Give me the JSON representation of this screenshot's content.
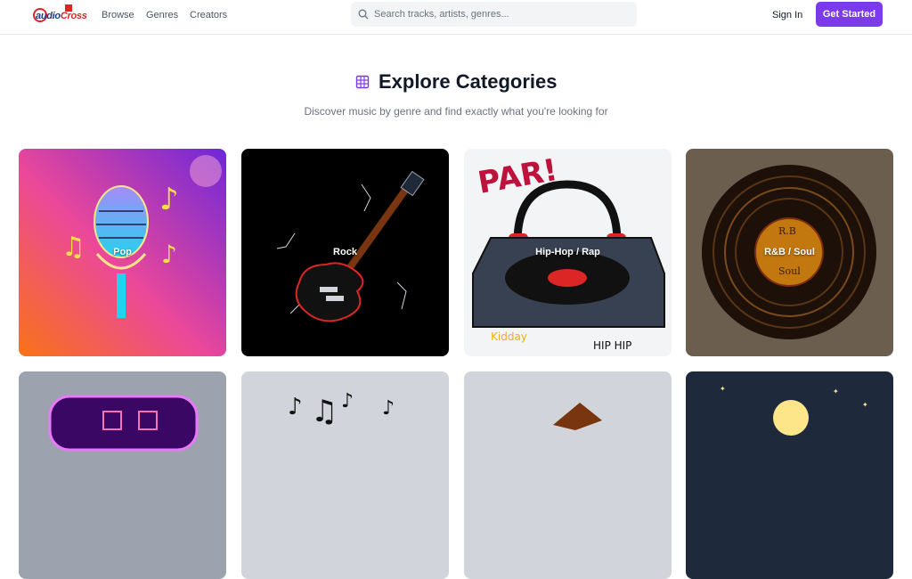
{
  "logo": {
    "text_main": "audio",
    "text_accent": "Cross"
  },
  "nav": {
    "links": [
      "Browse",
      "Genres",
      "Creators"
    ]
  },
  "search": {
    "placeholder": "Search tracks, artists, genres..."
  },
  "auth": {
    "sign_in": "Sign In",
    "get_started": "Get Started"
  },
  "page": {
    "title": "Explore Categories",
    "subtitle": "Discover music by genre and find exactly what you're looking for"
  },
  "categories": [
    {
      "label": "Pop"
    },
    {
      "label": "Rock"
    },
    {
      "label": "Hip-Hop / Rap"
    },
    {
      "label": "R&B / Soul"
    },
    {
      "label": ""
    },
    {
      "label": ""
    },
    {
      "label": ""
    },
    {
      "label": ""
    }
  ],
  "colors": {
    "accent": "#7c3aed",
    "text": "#111827",
    "muted": "#6b7280"
  }
}
